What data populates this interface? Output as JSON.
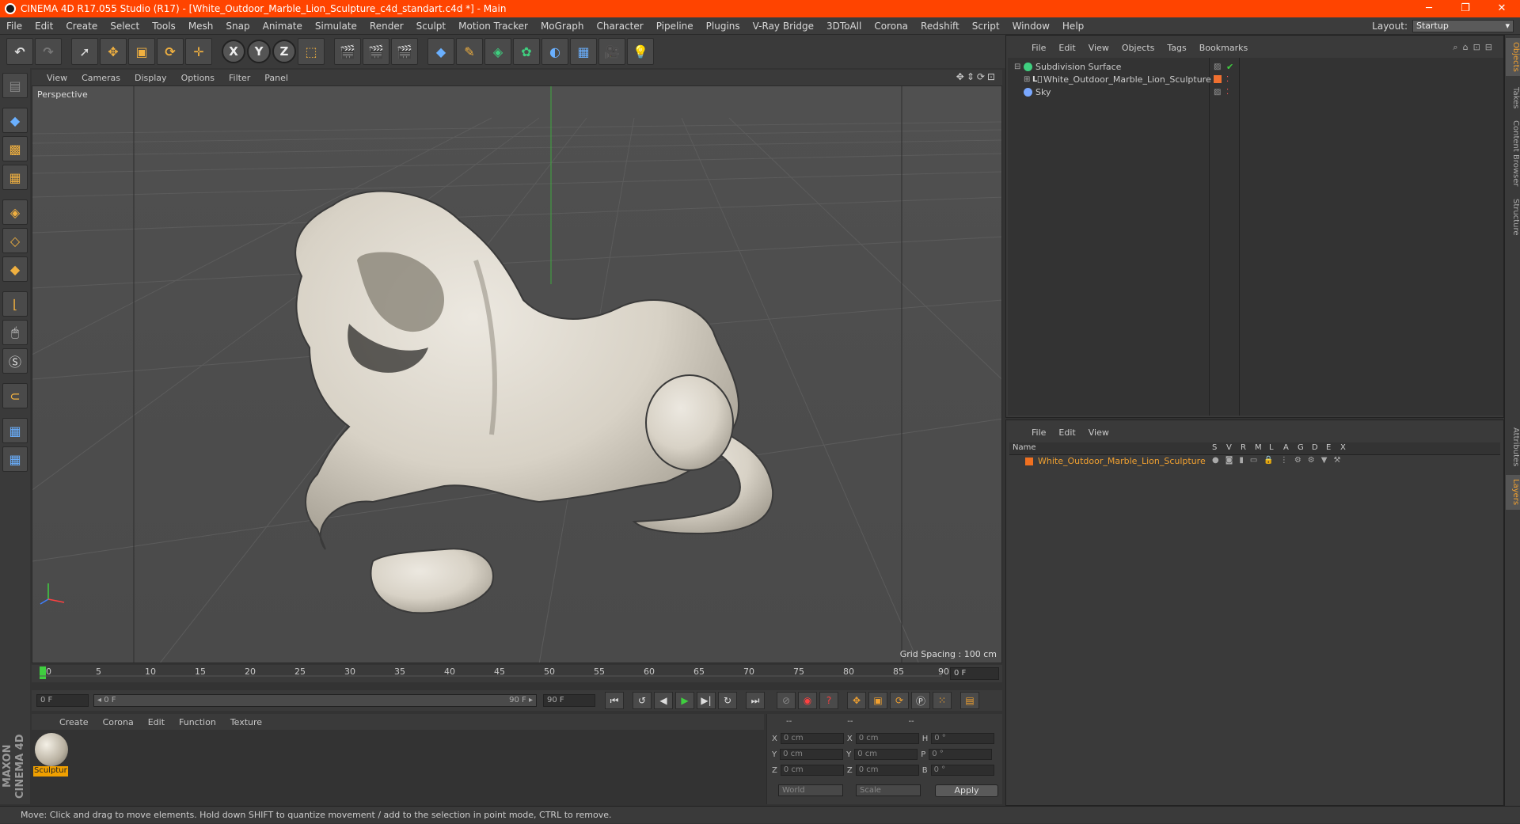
{
  "window": {
    "title": "CINEMA 4D R17.055 Studio (R17) - [White_Outdoor_Marble_Lion_Sculpture_c4d_standart.c4d *] - Main",
    "controls": [
      "─",
      "❐",
      "✕"
    ]
  },
  "menubar": {
    "items": [
      "File",
      "Edit",
      "Create",
      "Select",
      "Tools",
      "Mesh",
      "Snap",
      "Animate",
      "Simulate",
      "Render",
      "Sculpt",
      "Motion Tracker",
      "MoGraph",
      "Character",
      "Pipeline",
      "Plugins",
      "V-Ray Bridge",
      "3DToAll",
      "Corona",
      "Redshift",
      "Script",
      "Window",
      "Help"
    ],
    "layout_label": "Layout:",
    "layout_value": "Startup"
  },
  "toolbar": {
    "icons": [
      "undo-icon",
      "redo-icon",
      "select-arrow-icon",
      "move-icon",
      "scale-icon",
      "rotate-icon",
      "live-select-icon",
      "x-axis-icon",
      "y-axis-icon",
      "z-axis-icon",
      "world-coord-icon",
      "render-view-icon",
      "render-picture-queue-icon",
      "render-settings-icon",
      "cube-icon",
      "pen-spline-icon",
      "subdivision-icon",
      "cloner-icon",
      "deformer-icon",
      "floor-icon",
      "camera-icon",
      "light-icon"
    ],
    "axis_labels": [
      "X",
      "Y",
      "Z"
    ]
  },
  "left_tools": [
    "model-mode-icon",
    "texture-mode-icon",
    "workplane-icon",
    "points-mode-icon",
    "edges-mode-icon",
    "polygons-mode-icon",
    "axis-mode-icon",
    "tweak-icon",
    "snap-icon",
    "magnet-icon",
    "grid-lock-icon",
    "grid-snap-icon"
  ],
  "viewport": {
    "menu": [
      "View",
      "Cameras",
      "Display",
      "Options",
      "Filter",
      "Panel"
    ],
    "label": "Perspective",
    "grid_spacing": "Grid Spacing : 100 cm",
    "nav_icons": "✥⇕⟳⊡"
  },
  "timeline": {
    "ticks": [
      "0",
      "5",
      "10",
      "15",
      "20",
      "25",
      "30",
      "35",
      "40",
      "45",
      "50",
      "55",
      "60",
      "65",
      "70",
      "75",
      "80",
      "85",
      "90"
    ],
    "current_frame": "0 F"
  },
  "transport": {
    "start_field": "0 F",
    "range_start": "◂ 0 F",
    "range_end": "90 F ▸",
    "end_field": "90 F"
  },
  "material_manager": {
    "menu": [
      "Create",
      "Corona",
      "Edit",
      "Function",
      "Texture"
    ],
    "material_name": "Sculptur"
  },
  "coordinates": {
    "header": [
      "--",
      "--",
      "--"
    ],
    "rows": [
      {
        "a": "X",
        "av": "0 cm",
        "b": "X",
        "bv": "0 cm",
        "c": "H",
        "cv": "0 °"
      },
      {
        "a": "Y",
        "av": "0 cm",
        "b": "Y",
        "bv": "0 cm",
        "c": "P",
        "cv": "0 °"
      },
      {
        "a": "Z",
        "av": "0 cm",
        "b": "Z",
        "bv": "0 cm",
        "c": "B",
        "cv": "0 °"
      }
    ],
    "mode_dropdown": "World",
    "scale_dropdown": "Scale",
    "apply_label": "Apply"
  },
  "status": "Move: Click and drag to move elements. Hold down SHIFT to quantize movement / add to the selection in point mode, CTRL to remove.",
  "maxon_logo": "MAXON CINEMA 4D",
  "object_manager": {
    "menu": [
      "File",
      "Edit",
      "View",
      "Objects",
      "Tags",
      "Bookmarks"
    ],
    "objects": [
      {
        "name": "Subdivision Surface",
        "color": "#3fcf7f",
        "indent": 0
      },
      {
        "name": "White_Outdoor_Marble_Lion_Sculpture",
        "color": "#f07030",
        "indent": 1
      },
      {
        "name": "Sky",
        "color": "#7aa8ff",
        "indent": 0
      }
    ]
  },
  "layer_manager": {
    "menu": [
      "File",
      "Edit",
      "View"
    ],
    "header_name": "Name",
    "header_flags": [
      "S",
      "V",
      "R",
      "M",
      "L",
      "A",
      "G",
      "D",
      "E",
      "X"
    ],
    "layer_name": "White_Outdoor_Marble_Lion_Sculpture",
    "layer_color": "#f07020"
  },
  "right_tabs": [
    "Objects",
    "Takes",
    "Content Browser",
    "Structure",
    "Attributes",
    "Layers"
  ],
  "colors": {
    "titlebar": "#ff4400",
    "accent": "#f0a030"
  }
}
